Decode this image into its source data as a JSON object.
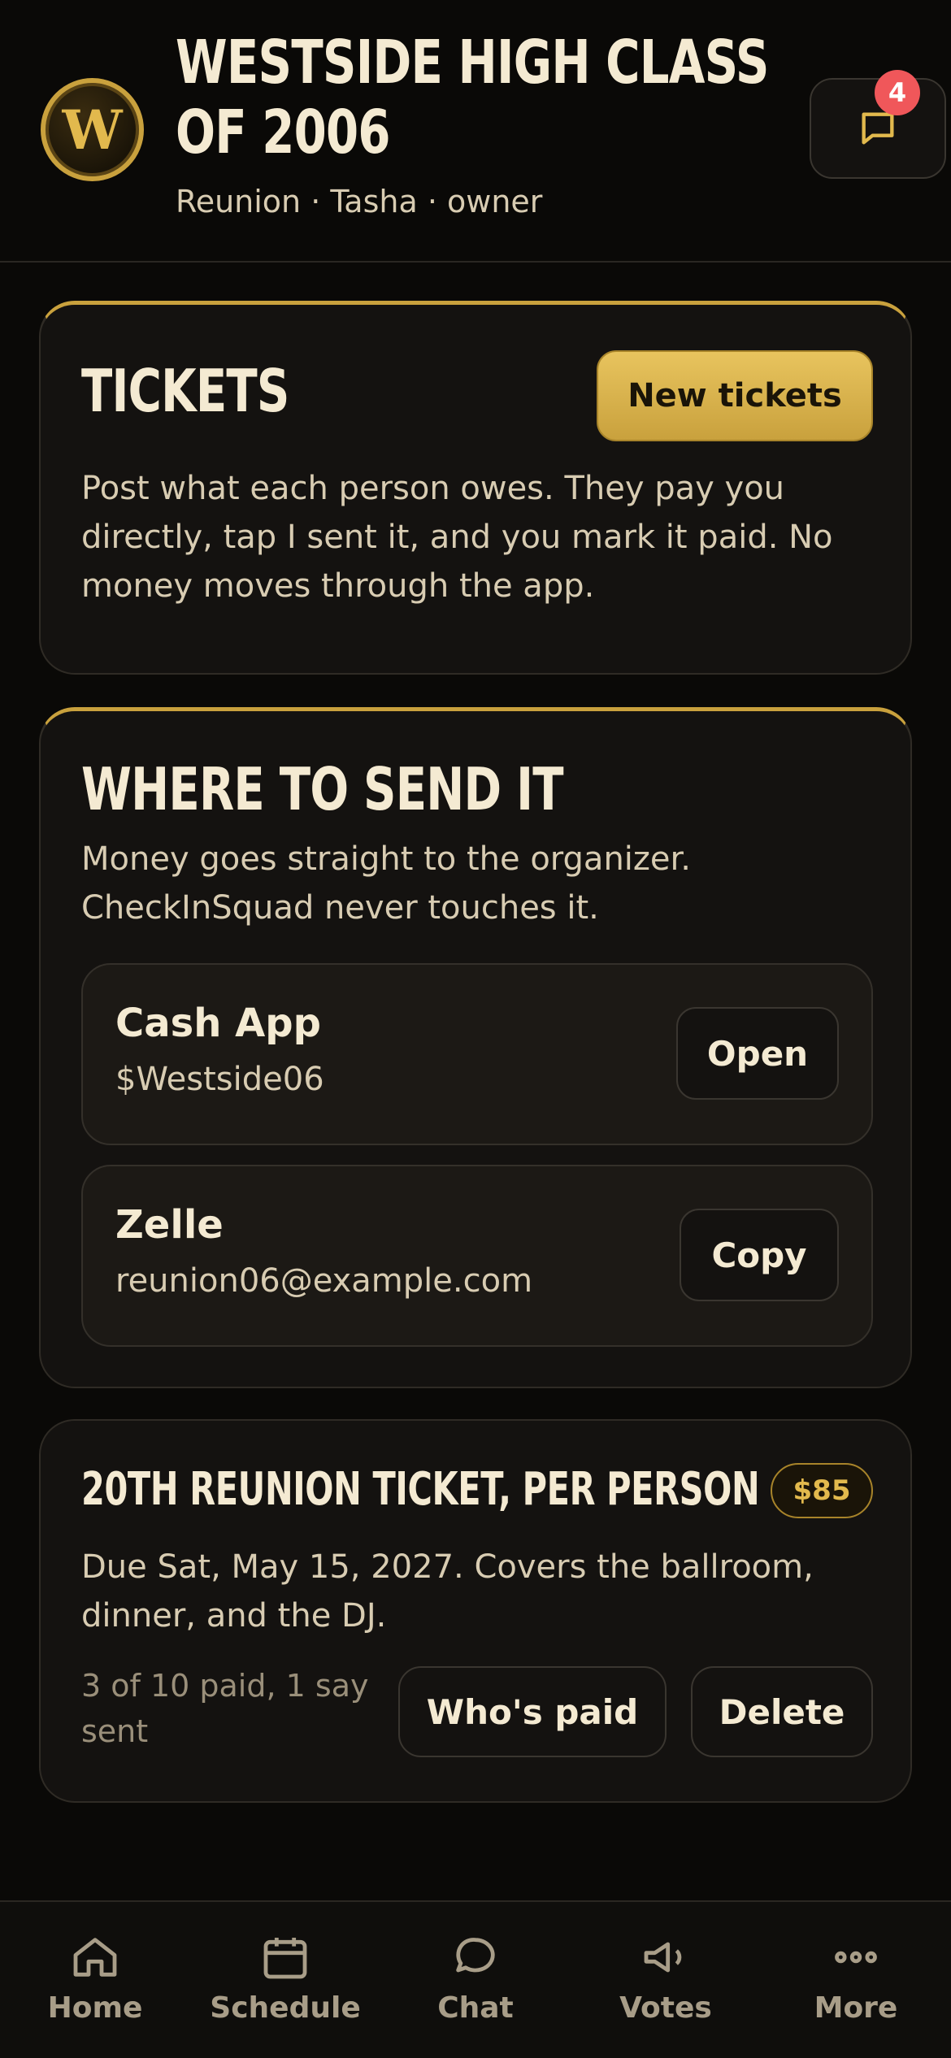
{
  "header": {
    "logo_letter": "W",
    "title": "WESTSIDE HIGH CLASS OF 2006",
    "subtitle": "Reunion · Tasha · owner",
    "chat_badge": "4"
  },
  "tickets_card": {
    "heading": "TICKETS",
    "new_button": "New tickets",
    "description": "Post what each person owes. They pay you directly, tap I sent it, and you mark it paid. No money moves through the app."
  },
  "send_card": {
    "heading": "WHERE TO SEND IT",
    "description": "Money goes straight to the organizer. CheckInSquad never touches it.",
    "methods": [
      {
        "name": "Cash App",
        "value": "$Westside06",
        "button": "Open"
      },
      {
        "name": "Zelle",
        "value": "reunion06@example.com",
        "button": "Copy"
      }
    ]
  },
  "ticket": {
    "name": "20TH REUNION TICKET, PER PERSON",
    "price": "$85",
    "description": "Due Sat, May 15, 2027. Covers the ballroom, dinner, and the DJ.",
    "status": "3 of 10 paid, 1 say sent",
    "whos_paid_button": "Who's paid",
    "delete_button": "Delete"
  },
  "nav": {
    "items": [
      {
        "label": "Home",
        "icon": "home-icon"
      },
      {
        "label": "Schedule",
        "icon": "calendar-icon"
      },
      {
        "label": "Chat",
        "icon": "chat-icon"
      },
      {
        "label": "Votes",
        "icon": "megaphone-icon"
      },
      {
        "label": "More",
        "icon": "more-icon"
      }
    ]
  },
  "colors": {
    "background": "#0a0907",
    "card": "#141210",
    "accent_gold": "#c9a13d",
    "badge_red": "#f0575a"
  }
}
